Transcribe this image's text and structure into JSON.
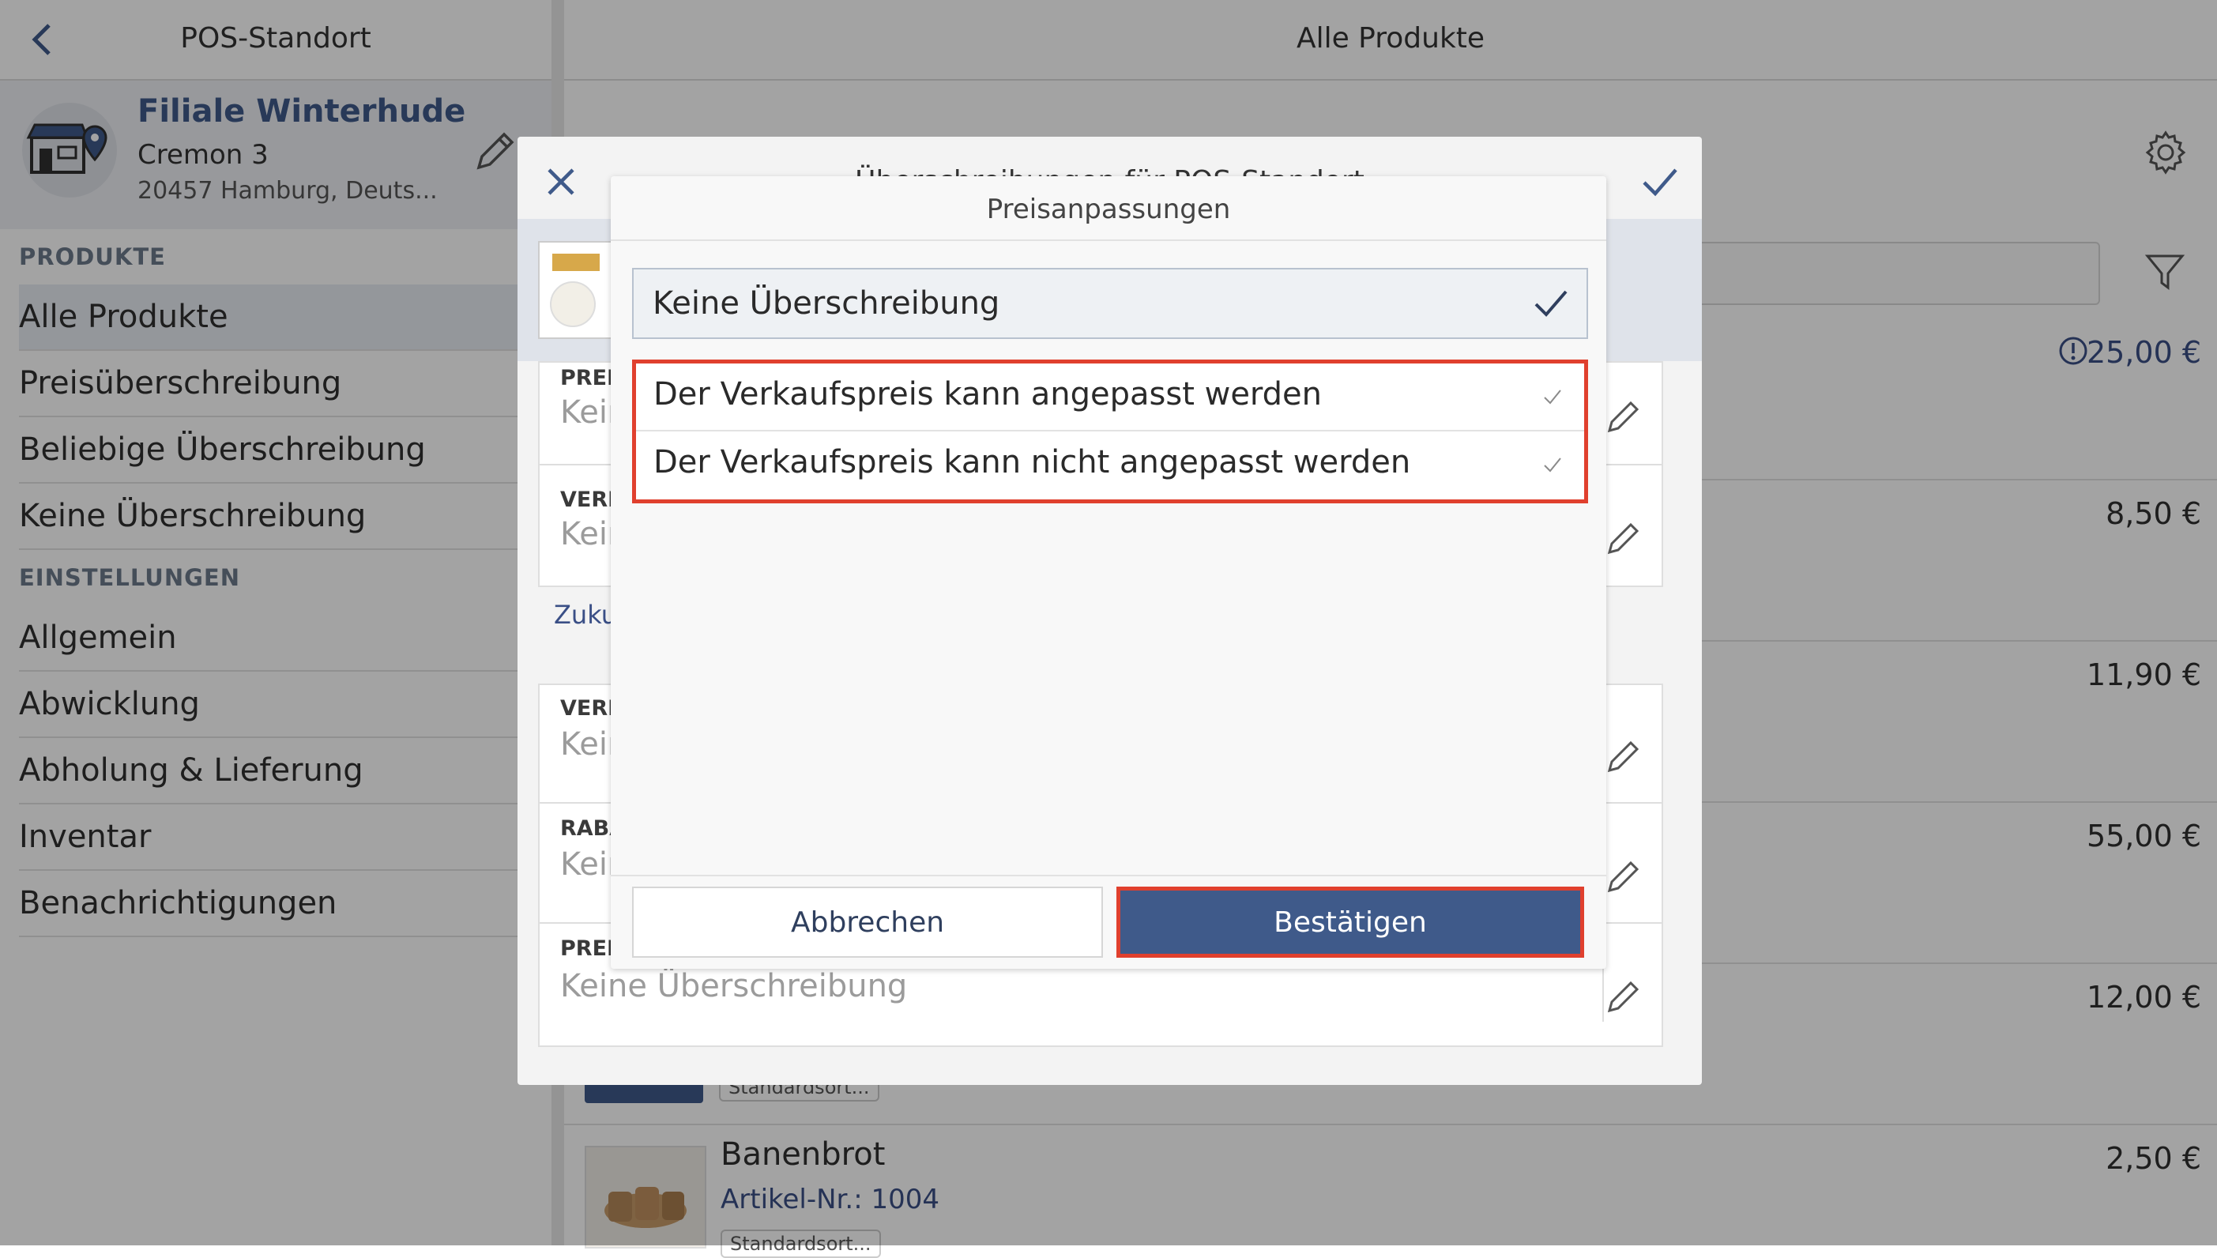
{
  "sidebar": {
    "top_title": "POS-Standort",
    "location": {
      "name": "Filiale Winterhude",
      "street": "Cremon 3",
      "city": "20457 Hamburg, Deuts..."
    },
    "section_products": "PRODUKTE",
    "products_items": [
      "Alle Produkte",
      "Preisüberschreibung",
      "Beliebige Überschreibung",
      "Keine Überschreibung"
    ],
    "section_settings": "EINSTELLUNGEN",
    "settings_items": [
      "Allgemein",
      "Abwicklung",
      "Abholung & Lieferung",
      "Inventar",
      "Benachrichtigungen"
    ]
  },
  "main": {
    "title": "Alle Produkte",
    "prices": [
      "25,00 €",
      "8,50 €",
      "11,90 €",
      "55,00 €",
      "12,00 €",
      "2,50 €"
    ],
    "bottom_product": {
      "name": "Banenbrot",
      "article": "Artikel-Nr.: 1004",
      "tag": "Standardsort..."
    },
    "partial_tag": "Standardsort..."
  },
  "override_modal": {
    "title": "Überschreibungen für POS-Standort",
    "fields": [
      {
        "label": "PREIS",
        "value": "Kein"
      },
      {
        "label": "VERK",
        "value": "Kein"
      },
      {
        "label": "VERK",
        "value": "Kein"
      },
      {
        "label": "RABA",
        "value": "Kein"
      },
      {
        "label": "PREIS",
        "value": "Keine Überschreibung"
      }
    ],
    "link_text": "Zukun"
  },
  "dialog": {
    "title": "Preisanpassungen",
    "selected_option": "Keine Überschreibung",
    "options": [
      "Der Verkaufspreis kann angepasst werden",
      "Der Verkaufspreis kann nicht angepasst werden"
    ],
    "cancel_label": "Abbrechen",
    "confirm_label": "Bestätigen"
  },
  "colors": {
    "primary": "#3f5a8a",
    "highlight": "#e0402e",
    "link": "#3a4f86"
  }
}
